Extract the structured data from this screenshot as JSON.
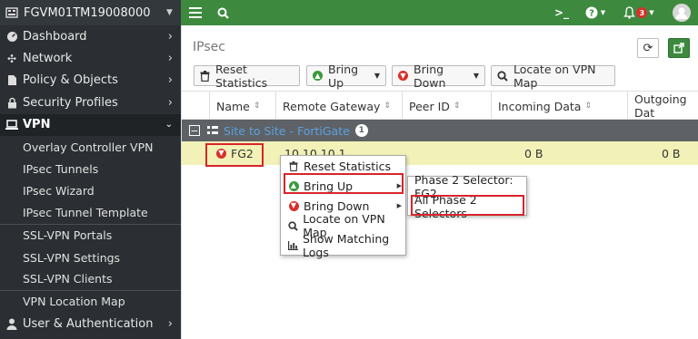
{
  "sidebar": {
    "device_name": "FGVM01TM19008000",
    "items": [
      {
        "label": "Dashboard",
        "icon": "dashboard-icon"
      },
      {
        "label": "Network",
        "icon": "network-icon"
      },
      {
        "label": "Policy & Objects",
        "icon": "policy-icon"
      },
      {
        "label": "Security Profiles",
        "icon": "lock-icon"
      },
      {
        "label": "VPN",
        "icon": "laptop-icon"
      }
    ],
    "vpn_subitems": [
      "Overlay Controller VPN",
      "IPsec Tunnels",
      "IPsec Wizard",
      "IPsec Tunnel Template",
      "SSL-VPN Portals",
      "SSL-VPN Settings",
      "SSL-VPN Clients",
      "VPN Location Map"
    ],
    "bottom_item": {
      "label": "User & Authentication",
      "icon": "user-icon"
    }
  },
  "topbar": {
    "cli_icon": ">_",
    "help_icon": "help-icon",
    "notification_count": "3",
    "accent": "#3d8a3f"
  },
  "page": {
    "title": "IPsec"
  },
  "toolbar": {
    "reset": "Reset Statistics",
    "bring_up": "Bring Up",
    "bring_down": "Bring Down",
    "locate": "Locate on VPN Map"
  },
  "table": {
    "columns": [
      "Name",
      "Remote Gateway",
      "Peer ID",
      "Incoming Data",
      "Outgoing Dat"
    ],
    "group": {
      "label": "Site to Site - FortiGate",
      "count": "1"
    },
    "rows": [
      {
        "name": "FG2",
        "remote_gateway": "10.10.10.1",
        "peer_id": "",
        "incoming": "0 B",
        "outgoing": "0 B"
      }
    ]
  },
  "context_menu": {
    "items": [
      "Reset Statistics",
      "Bring Up",
      "Bring Down",
      "Locate on VPN Map",
      "Show Matching Logs"
    ]
  },
  "submenu": {
    "items": [
      "Phase 2 Selector: FG2",
      "All Phase 2 Selectors"
    ]
  },
  "colors": {
    "highlight": "#d8242a",
    "row_selected": "#f2f2b8",
    "group_row": "#5e6266"
  }
}
